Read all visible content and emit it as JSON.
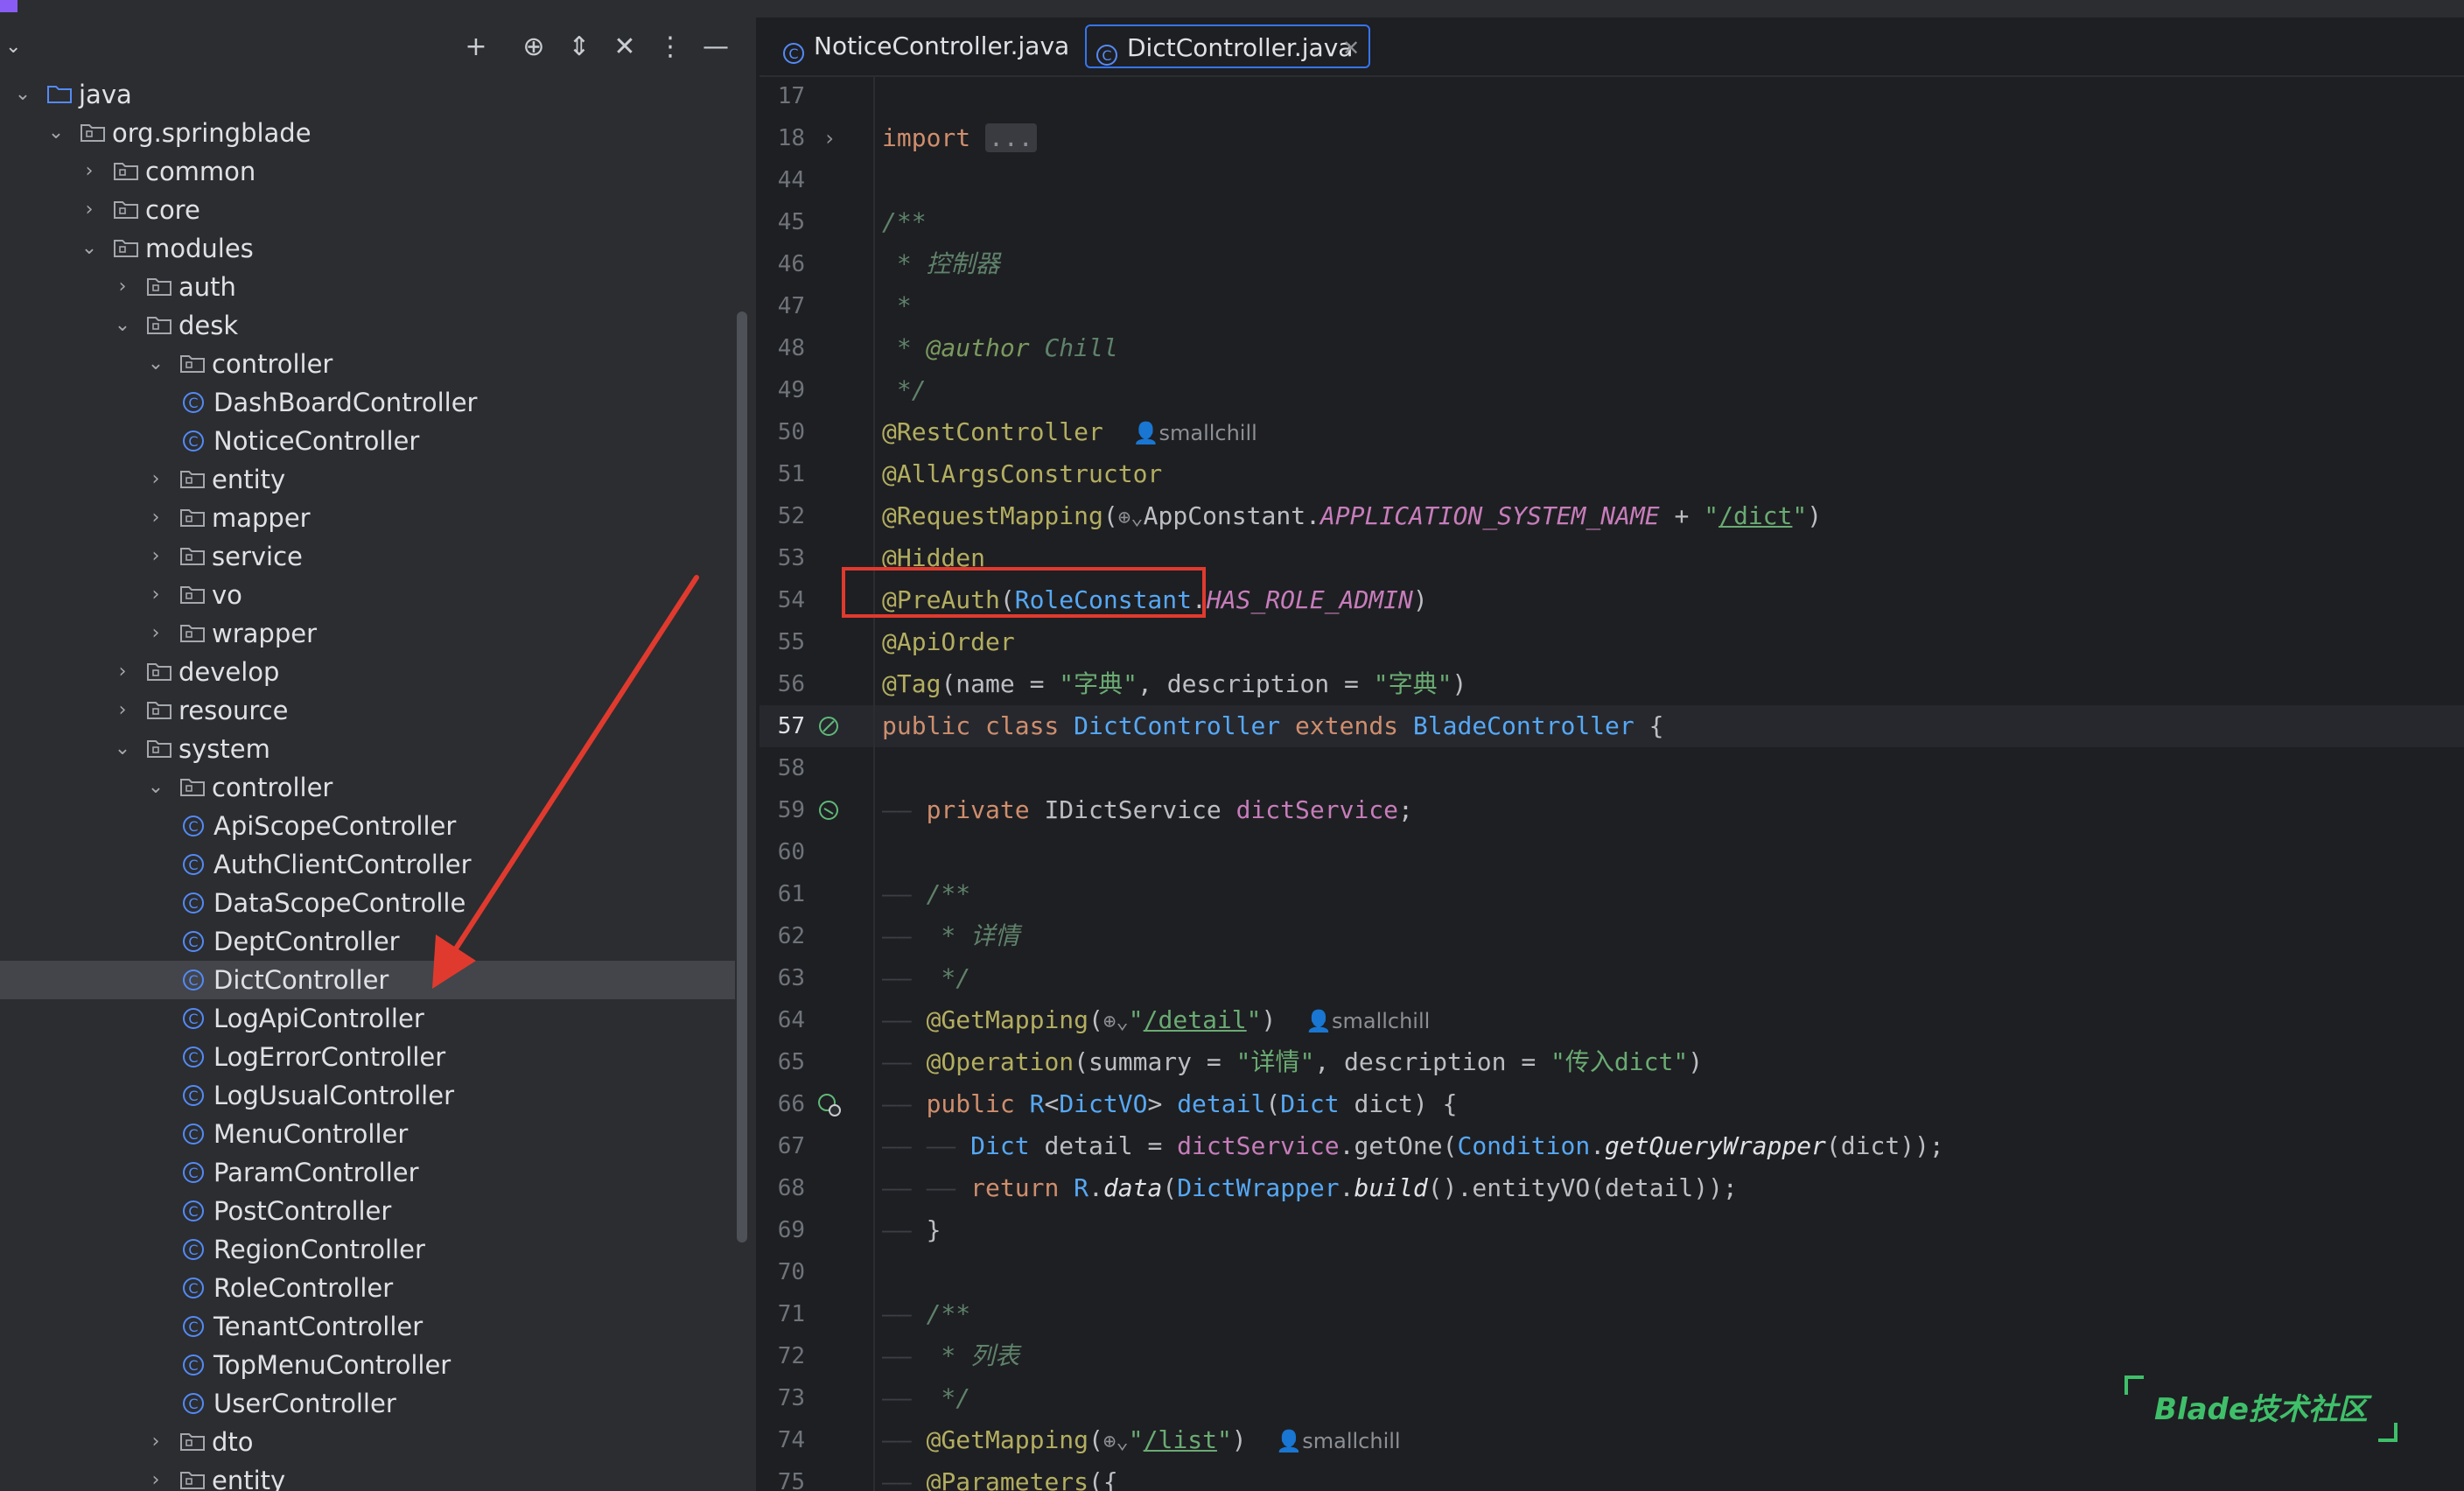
{
  "project": {
    "tree": [
      {
        "label": "java",
        "depth": 0,
        "expanded": true,
        "kind": "source-folder"
      },
      {
        "label": "org.springblade",
        "depth": 1,
        "expanded": true,
        "kind": "package"
      },
      {
        "label": "common",
        "depth": 2,
        "expanded": false,
        "kind": "package"
      },
      {
        "label": "core",
        "depth": 2,
        "expanded": false,
        "kind": "package"
      },
      {
        "label": "modules",
        "depth": 2,
        "expanded": true,
        "kind": "package"
      },
      {
        "label": "auth",
        "depth": 3,
        "expanded": false,
        "kind": "package"
      },
      {
        "label": "desk",
        "depth": 3,
        "expanded": true,
        "kind": "package"
      },
      {
        "label": "controller",
        "depth": 4,
        "expanded": true,
        "kind": "package"
      },
      {
        "label": "DashBoardController",
        "depth": 5,
        "kind": "class"
      },
      {
        "label": "NoticeController",
        "depth": 5,
        "kind": "class"
      },
      {
        "label": "entity",
        "depth": 4,
        "expanded": false,
        "kind": "package"
      },
      {
        "label": "mapper",
        "depth": 4,
        "expanded": false,
        "kind": "package"
      },
      {
        "label": "service",
        "depth": 4,
        "expanded": false,
        "kind": "package"
      },
      {
        "label": "vo",
        "depth": 4,
        "expanded": false,
        "kind": "package"
      },
      {
        "label": "wrapper",
        "depth": 4,
        "expanded": false,
        "kind": "package"
      },
      {
        "label": "develop",
        "depth": 3,
        "expanded": false,
        "kind": "package"
      },
      {
        "label": "resource",
        "depth": 3,
        "expanded": false,
        "kind": "package"
      },
      {
        "label": "system",
        "depth": 3,
        "expanded": true,
        "kind": "package"
      },
      {
        "label": "controller",
        "depth": 4,
        "expanded": true,
        "kind": "package"
      },
      {
        "label": "ApiScopeController",
        "depth": 5,
        "kind": "class"
      },
      {
        "label": "AuthClientController",
        "depth": 5,
        "kind": "class"
      },
      {
        "label": "DataScopeControlle",
        "depth": 5,
        "kind": "class"
      },
      {
        "label": "DeptController",
        "depth": 5,
        "kind": "class"
      },
      {
        "label": "DictController",
        "depth": 5,
        "kind": "class",
        "selected": true
      },
      {
        "label": "LogApiController",
        "depth": 5,
        "kind": "class"
      },
      {
        "label": "LogErrorController",
        "depth": 5,
        "kind": "class"
      },
      {
        "label": "LogUsualController",
        "depth": 5,
        "kind": "class"
      },
      {
        "label": "MenuController",
        "depth": 5,
        "kind": "class"
      },
      {
        "label": "ParamController",
        "depth": 5,
        "kind": "class"
      },
      {
        "label": "PostController",
        "depth": 5,
        "kind": "class"
      },
      {
        "label": "RegionController",
        "depth": 5,
        "kind": "class"
      },
      {
        "label": "RoleController",
        "depth": 5,
        "kind": "class"
      },
      {
        "label": "TenantController",
        "depth": 5,
        "kind": "class"
      },
      {
        "label": "TopMenuController",
        "depth": 5,
        "kind": "class"
      },
      {
        "label": "UserController",
        "depth": 5,
        "kind": "class"
      },
      {
        "label": "dto",
        "depth": 4,
        "expanded": false,
        "kind": "package"
      },
      {
        "label": "entity",
        "depth": 4,
        "expanded": false,
        "kind": "package"
      }
    ]
  },
  "tabs": [
    {
      "label": "NoticeController.java",
      "active": false
    },
    {
      "label": "DictController.java",
      "active": true
    }
  ],
  "code_lines": [
    {
      "num": "17",
      "tokens": []
    },
    {
      "num": "18",
      "gutter": "fold",
      "tokens": [
        [
          "kw",
          "import"
        ],
        [
          "pl",
          " "
        ],
        [
          "fold",
          "..."
        ]
      ]
    },
    {
      "num": "44",
      "tokens": []
    },
    {
      "num": "45",
      "tokens": [
        [
          "cmt",
          "/**"
        ]
      ]
    },
    {
      "num": "46",
      "tokens": [
        [
          "cmt",
          " * 控制器"
        ]
      ]
    },
    {
      "num": "47",
      "tokens": [
        [
          "cmt",
          " *"
        ]
      ]
    },
    {
      "num": "48",
      "tokens": [
        [
          "cmt",
          " * "
        ],
        [
          "cm",
          "@author"
        ],
        [
          "cmt",
          " Chill"
        ]
      ]
    },
    {
      "num": "49",
      "tokens": [
        [
          "cmt",
          " */"
        ]
      ]
    },
    {
      "num": "50",
      "tokens": [
        [
          "an",
          "@RestController"
        ],
        [
          "pl",
          "  "
        ],
        [
          "hint",
          "👤smallchill"
        ]
      ]
    },
    {
      "num": "51",
      "tokens": [
        [
          "an",
          "@AllArgsConstructor"
        ]
      ]
    },
    {
      "num": "52",
      "tokens": [
        [
          "an",
          "@RequestMapping"
        ],
        [
          "pl",
          "("
        ],
        [
          "glob",
          "⊕⌄"
        ],
        [
          "pl",
          "AppConstant."
        ],
        [
          "cst",
          "APPLICATION_SYSTEM_NAME"
        ],
        [
          "pl",
          " + "
        ],
        [
          "st",
          "\""
        ],
        [
          "stu",
          "/dict"
        ],
        [
          "st",
          "\""
        ],
        [
          "pl",
          ")"
        ]
      ]
    },
    {
      "num": "53",
      "tokens": [
        [
          "an",
          "@Hidden"
        ]
      ]
    },
    {
      "num": "54",
      "tokens": [
        [
          "an",
          "@PreAuth"
        ],
        [
          "pl",
          "("
        ],
        [
          "cls",
          "RoleConstant"
        ],
        [
          "pl",
          "."
        ],
        [
          "cst",
          "HAS_ROLE_ADMIN"
        ],
        [
          "pl",
          ")"
        ]
      ]
    },
    {
      "num": "55",
      "tokens": [
        [
          "an",
          "@ApiOrder"
        ]
      ]
    },
    {
      "num": "56",
      "tokens": [
        [
          "an",
          "@Tag"
        ],
        [
          "pl",
          "(name = "
        ],
        [
          "st",
          "\"字典\""
        ],
        [
          "pl",
          ", description = "
        ],
        [
          "st",
          "\"字典\""
        ],
        [
          "pl",
          ")"
        ]
      ]
    },
    {
      "num": "57",
      "caret": true,
      "gutter": "bean",
      "tokens": [
        [
          "kw",
          "public class "
        ],
        [
          "cls",
          "DictController"
        ],
        [
          "pl",
          " "
        ],
        [
          "kw",
          "extends "
        ],
        [
          "cls",
          "BladeController"
        ],
        [
          "pl",
          " {"
        ]
      ]
    },
    {
      "num": "58",
      "tokens": []
    },
    {
      "num": "59",
      "gutter": "inject",
      "tokens": [
        [
          "guide",
          "——"
        ],
        [
          "pl",
          " "
        ],
        [
          "kw",
          "private "
        ],
        [
          "pl",
          "IDictService "
        ],
        [
          "fld",
          "dictService"
        ],
        [
          "pl",
          ";"
        ]
      ]
    },
    {
      "num": "60",
      "tokens": []
    },
    {
      "num": "61",
      "tokens": [
        [
          "guide",
          "——"
        ],
        [
          "pl",
          " "
        ],
        [
          "cmt",
          "/**"
        ]
      ]
    },
    {
      "num": "62",
      "tokens": [
        [
          "guide",
          "——"
        ],
        [
          "pl",
          " "
        ],
        [
          "cmt",
          " * 详情"
        ]
      ]
    },
    {
      "num": "63",
      "tokens": [
        [
          "guide",
          "——"
        ],
        [
          "pl",
          " "
        ],
        [
          "cmt",
          " */"
        ]
      ]
    },
    {
      "num": "64",
      "tokens": [
        [
          "guide",
          "——"
        ],
        [
          "pl",
          " "
        ],
        [
          "an",
          "@GetMapping"
        ],
        [
          "pl",
          "("
        ],
        [
          "glob",
          "⊕⌄"
        ],
        [
          "st",
          "\""
        ],
        [
          "stu",
          "/detail"
        ],
        [
          "st",
          "\""
        ],
        [
          "pl",
          ")  "
        ],
        [
          "hint",
          "👤smallchill"
        ]
      ]
    },
    {
      "num": "65",
      "tokens": [
        [
          "guide",
          "——"
        ],
        [
          "pl",
          " "
        ],
        [
          "an",
          "@Operation"
        ],
        [
          "pl",
          "(summary = "
        ],
        [
          "st",
          "\"详情\""
        ],
        [
          "pl",
          ", description = "
        ],
        [
          "st",
          "\"传入dict\""
        ],
        [
          "pl",
          ")"
        ]
      ]
    },
    {
      "num": "66",
      "gutter": "web",
      "tokens": [
        [
          "guide",
          "——"
        ],
        [
          "pl",
          " "
        ],
        [
          "kw",
          "public "
        ],
        [
          "cls",
          "R"
        ],
        [
          "pl",
          "<"
        ],
        [
          "cls",
          "DictVO"
        ],
        [
          "pl",
          "> "
        ],
        [
          "mth",
          "detail"
        ],
        [
          "pl",
          "("
        ],
        [
          "cls",
          "Dict"
        ],
        [
          "pl",
          " dict) {"
        ]
      ]
    },
    {
      "num": "67",
      "tokens": [
        [
          "guide",
          "——"
        ],
        [
          "pl",
          " "
        ],
        [
          "guide",
          "——"
        ],
        [
          "pl",
          " "
        ],
        [
          "cls",
          "Dict"
        ],
        [
          "pl",
          " detail = "
        ],
        [
          "fld",
          "dictService"
        ],
        [
          "pl",
          ".getOne("
        ],
        [
          "cls",
          "Condition"
        ],
        [
          "pl",
          "."
        ],
        [
          "ital",
          "getQueryWrapper"
        ],
        [
          "pl",
          "(dict));"
        ]
      ]
    },
    {
      "num": "68",
      "tokens": [
        [
          "guide",
          "——"
        ],
        [
          "pl",
          " "
        ],
        [
          "guide",
          "——"
        ],
        [
          "pl",
          " "
        ],
        [
          "kw",
          "return "
        ],
        [
          "cls",
          "R"
        ],
        [
          "pl",
          "."
        ],
        [
          "ital",
          "data"
        ],
        [
          "pl",
          "("
        ],
        [
          "cls",
          "DictWrapper"
        ],
        [
          "pl",
          "."
        ],
        [
          "ital",
          "build"
        ],
        [
          "pl",
          "().entityVO(detail));"
        ]
      ]
    },
    {
      "num": "69",
      "tokens": [
        [
          "guide",
          "——"
        ],
        [
          "pl",
          " }"
        ]
      ]
    },
    {
      "num": "70",
      "tokens": []
    },
    {
      "num": "71",
      "tokens": [
        [
          "guide",
          "——"
        ],
        [
          "pl",
          " "
        ],
        [
          "cmt",
          "/**"
        ]
      ]
    },
    {
      "num": "72",
      "tokens": [
        [
          "guide",
          "——"
        ],
        [
          "pl",
          " "
        ],
        [
          "cmt",
          " * 列表"
        ]
      ]
    },
    {
      "num": "73",
      "tokens": [
        [
          "guide",
          "——"
        ],
        [
          "pl",
          " "
        ],
        [
          "cmt",
          " */"
        ]
      ]
    },
    {
      "num": "74",
      "tokens": [
        [
          "guide",
          "——"
        ],
        [
          "pl",
          " "
        ],
        [
          "an",
          "@GetMapping"
        ],
        [
          "pl",
          "("
        ],
        [
          "glob",
          "⊕⌄"
        ],
        [
          "st",
          "\""
        ],
        [
          "stu",
          "/list"
        ],
        [
          "st",
          "\""
        ],
        [
          "pl",
          ")  "
        ],
        [
          "hint",
          "👤smallchill"
        ]
      ]
    },
    {
      "num": "75",
      "tokens": [
        [
          "guide",
          "——"
        ],
        [
          "pl",
          " "
        ],
        [
          "an",
          "@Parameters"
        ],
        [
          "pl",
          "({"
        ]
      ]
    }
  ],
  "watermark": "Blade技术社区",
  "colors": {
    "editor_bg": "#1e1f22",
    "panel_bg": "#2b2d30",
    "selection": "#43454a",
    "accent_tab": "#3574f0",
    "annotation_box": "#e03a2e",
    "arrow": "#e03a2e",
    "watermark": "#3fbf6a"
  },
  "icons": {
    "toolbar": [
      "plus-icon",
      "locate-icon",
      "expand-all-icon",
      "collapse-all-icon",
      "more-icon",
      "minimize-icon"
    ],
    "folder": "folder-icon",
    "package": "package-icon",
    "class": "java-class-icon"
  }
}
